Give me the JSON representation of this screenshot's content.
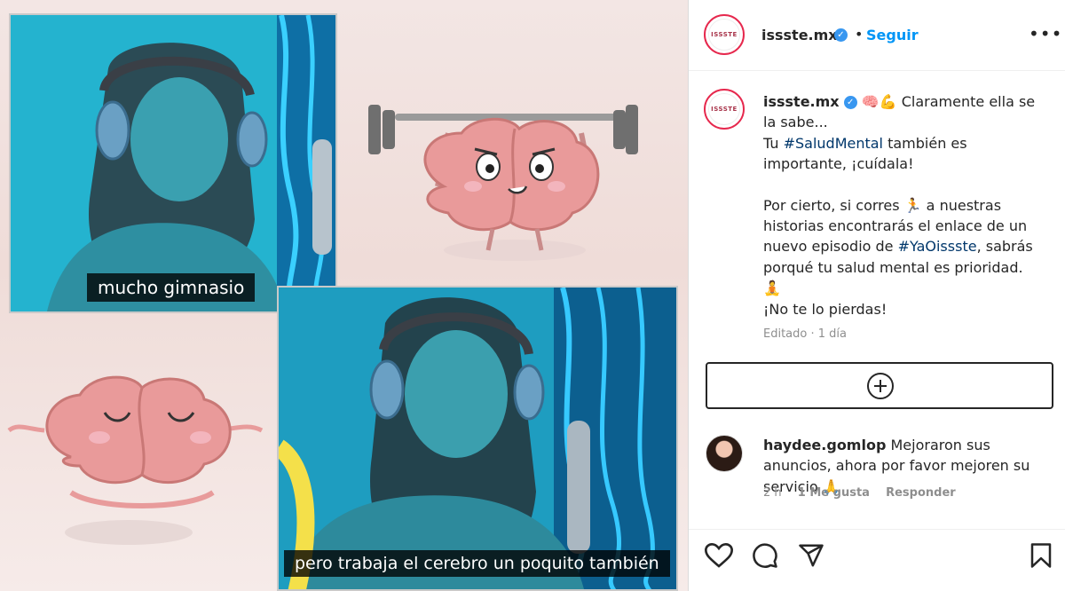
{
  "media": {
    "subtitle_1": "mucho gimnasio",
    "subtitle_2": "pero trabaja el cerebro un poquito también"
  },
  "header": {
    "logo_text": "ISSSTE",
    "username": "issste.mx",
    "separator": "•",
    "follow_label": "Seguir",
    "more_icon": "more-options-icon"
  },
  "caption": {
    "username": "issste.mx",
    "emojis_1": "🧠💪",
    "line_1": "Claramente ella se la sabe...",
    "line_2_pre": "Tu ",
    "hashtag_1": "#SaludMental",
    "line_2_post": " también es importante, ¡cuídala!",
    "line_3_pre": "Por cierto, si corres ",
    "runner_emoji": "🏃",
    "line_3_mid": " a nuestras historias encontrarás el enlace de un nuevo episodio de ",
    "hashtag_2": "#YaOissste",
    "line_3_post": ", sabrás porqué tu salud mental es prioridad.",
    "meditate_emoji": "🧘",
    "line_4": "¡No te lo pierdas!",
    "edited_time": "Editado · 1 día"
  },
  "add_button": {
    "icon": "add-circle-icon"
  },
  "comment": {
    "username": "haydee.gomlop",
    "text": "Mejoraron sus anuncios, ahora por favor mejoren su servicio",
    "emoji": "🙏",
    "time": "2 h",
    "likes": "1 Me gusta",
    "reply_label": "Responder"
  },
  "actions": {
    "like": "heart-icon",
    "comment": "comment-icon",
    "share": "send-icon",
    "save": "bookmark-icon"
  },
  "colors": {
    "accent_blue": "#0095f6",
    "hashtag": "#00376b",
    "muted": "#8e8e8e",
    "verified": "#3897f0"
  }
}
